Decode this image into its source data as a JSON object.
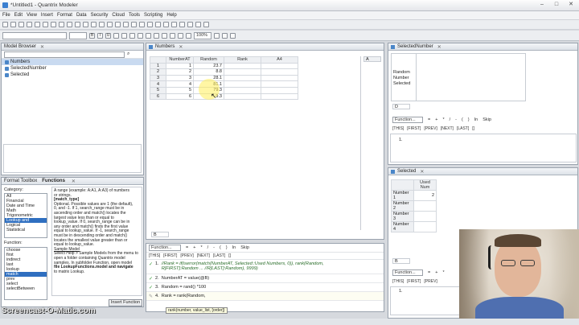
{
  "window": {
    "title": "*Untitled1 - Quantrix Modeler",
    "min": "–",
    "max": "□",
    "close": "✕"
  },
  "menu": [
    "File",
    "Edit",
    "View",
    "Insert",
    "Format",
    "Data",
    "Security",
    "Cloud",
    "Tools",
    "Scripting",
    "Help"
  ],
  "toolbar2": {
    "zoom": "100%"
  },
  "model_browser": {
    "title": "Model Browser",
    "items": [
      {
        "label": "Numbers"
      },
      {
        "label": "SelectedNumber"
      },
      {
        "label": "Selected"
      }
    ]
  },
  "functions_panel": {
    "tabs": [
      "Format Toolbox",
      "Functions"
    ],
    "category_label": "Category:",
    "categories": [
      "All",
      "Financial",
      "Date and Time",
      "Math",
      "Trigonometric",
      "Lookup and Reference",
      "Logical",
      "Statistical"
    ],
    "selected_category": "Lookup and Reference",
    "function_label": "Function:",
    "functions": [
      "choose",
      "first",
      "indirect",
      "last",
      "lookup",
      "match",
      "prev",
      "select",
      "selectBetween"
    ],
    "selected_function": "match",
    "help_text": [
      "A range (example: A:A1, A:A3) of numbers",
      "or strings.",
      "[match_type]",
      "Optional. Possible values are 1 (the default),",
      "0, and -1. If 1, search_range must be in",
      "ascending order and match() locates the",
      "largest value less than or equal to",
      "lookup_value. If 0, search_range can be in",
      "any order and match() finds the first value",
      "equal to lookup_value. If -1, search_range",
      "must be in descending order and match()",
      "locates the smallest value greater than or",
      "equal to lookup_value.",
      "Sample Model",
      "Select Help > Sample Models from the menu to",
      "open a folder containing Quantrix model",
      "samples. In subfolder Function, open model",
      "file LookupFunctions.model and navigate",
      "to matrix Lookup."
    ],
    "insert_button": "Insert Function"
  },
  "numbers_tab": {
    "title": "Numbers",
    "columns": [
      "NumberAT",
      "Random",
      "Rank",
      "A4"
    ],
    "rows": [
      {
        "h": "1",
        "numberat": "1",
        "random": "23.7",
        "rank": ""
      },
      {
        "h": "2",
        "numberat": "2",
        "random": "8.8",
        "rank": ""
      },
      {
        "h": "3",
        "numberat": "3",
        "random": "28.1",
        "rank": ""
      },
      {
        "h": "4",
        "numberat": "4",
        "random": "81.1",
        "rank": ""
      },
      {
        "h": "5",
        "numberat": "5",
        "random": "79.3",
        "rank": ""
      },
      {
        "h": "6",
        "numberat": "6",
        "random": "9.3",
        "rank": ""
      }
    ],
    "side_col": "A",
    "bottom_field": "B"
  },
  "formula_bar": {
    "function_label": "Function...",
    "ops": [
      "=",
      "+",
      "*",
      "/",
      "-",
      "(",
      ")",
      "In",
      "Skip"
    ],
    "nav": [
      "[THIS]",
      "[FIRST]",
      "[PREV]",
      "[NEXT]",
      "[LAST]",
      "[]"
    ],
    "lines": [
      {
        "n": "1.",
        "text": "//Rank = if(iserror(match(NumberAT, Selected::Used Numbers, 0)), rank(Random,",
        "text2": "R[FIRST]:Random ... //R[LAST]:Random), 9999)"
      },
      {
        "n": "2.",
        "text": "NumberAT = value(@B)"
      },
      {
        "n": "3.",
        "text": "Random = rand() *100"
      },
      {
        "n": "4.",
        "text": "Rank = rank(Random,"
      }
    ],
    "tooltip": "rank(number, value_list, [order])"
  },
  "selected_number": {
    "title": "SelectedNumber",
    "rows": [
      "Random",
      "Number",
      "Selected"
    ],
    "field": "D",
    "func_label": "Function...",
    "ops": [
      "=",
      "+",
      "*",
      "/",
      "-",
      "(",
      ")",
      "In",
      "Skip"
    ],
    "nav": [
      "[THIS]",
      "[FIRST]",
      "[PREV]",
      "[NEXT]",
      "[LAST]",
      "[]"
    ],
    "line": "1."
  },
  "selected": {
    "title": "Selected",
    "col": "Used Num",
    "rows": [
      {
        "h": "Number 1",
        "v": "2"
      },
      {
        "h": "Number 2",
        "v": ""
      },
      {
        "h": "Number 3",
        "v": ""
      },
      {
        "h": "Number 4",
        "v": ""
      }
    ],
    "field": "B",
    "func_label": "Function...",
    "ops": [
      "=",
      "+",
      "*",
      "/",
      "-",
      "(",
      ")",
      "In",
      "Skip"
    ],
    "nav": [
      "[THIS]",
      "[FIRST]",
      "[PREV]",
      "[NEXT]",
      "[LAST]",
      "[]"
    ],
    "line": "1."
  },
  "watermark": "Screencast-O-Matic.com"
}
